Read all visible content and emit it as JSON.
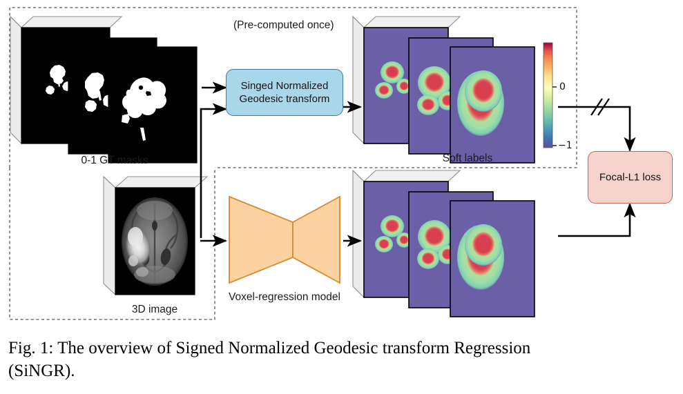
{
  "figure": {
    "caption_line1": "Fig. 1: The overview of Signed Normalized Geodesic transform Regression",
    "caption_line2": "(SiNGR)."
  },
  "annotations": {
    "precomputed_note": "(Pre-computed once)"
  },
  "stacks": {
    "gt_masks": {
      "label": "0-1 GT masks"
    },
    "soft_labels": {
      "label": "Soft labels"
    },
    "input_image": {
      "label": "3D image"
    },
    "predictions": {
      "label": ""
    }
  },
  "blocks": {
    "transform": {
      "line1": "Singed Normalized",
      "line2": "Geodesic transform",
      "fill": "#a9d7ea",
      "stroke": "#3f7f96"
    },
    "model": {
      "label": "Voxel-regression model",
      "fill": "#fbd2a0",
      "stroke": "#d68a32"
    },
    "loss": {
      "label": "Focal-L1 loss",
      "fill": "#f6d2cc",
      "stroke": "#c0665c"
    }
  },
  "colorbar": {
    "tick_top": "0",
    "tick_bottom": "−1",
    "colormap": "spectral-reversed",
    "stops": [
      "#5e4fa2",
      "#3288bd",
      "#66c2a5",
      "#abdda4",
      "#e6f598",
      "#ffffbf",
      "#fee08b",
      "#fdae61",
      "#f46d43",
      "#d53e4f",
      "#9e0142"
    ]
  },
  "palette": {
    "soft_background": "#6b5fa8",
    "soft_halo": "#9ee0a8",
    "soft_core": "#d44050",
    "slab_side": "#eaeaea",
    "slab_edge": "#9a9a9a",
    "mask_foreground": "#ffffff",
    "mask_background": "#000000",
    "dashed_border": "#555555",
    "arrow": "#000000"
  },
  "regions": {
    "precomputed_region": "dashed",
    "input_region": "dashed"
  }
}
